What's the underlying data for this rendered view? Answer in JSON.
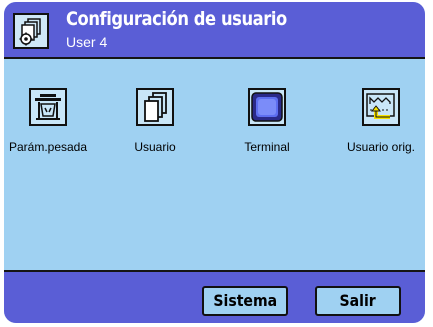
{
  "header": {
    "title": "Configuración de usuario",
    "subtitle": "User 4",
    "icon": "user-settings-icon"
  },
  "tiles": [
    {
      "label": "Parám.pesada",
      "icon": "scale-weighing-icon"
    },
    {
      "label": "Usuario",
      "icon": "user-pages-icon"
    },
    {
      "label": "Terminal",
      "icon": "terminal-screen-icon"
    },
    {
      "label": "Usuario orig.",
      "icon": "user-reset-icon"
    }
  ],
  "footer": {
    "sistema_label": "Sistema",
    "salir_label": "Salir"
  },
  "colors": {
    "header_bar": "#5a5ed6",
    "content_bg": "#9fd1f2",
    "button_bg": "#9fd1f2",
    "accent_yellow": "#f7e300"
  }
}
